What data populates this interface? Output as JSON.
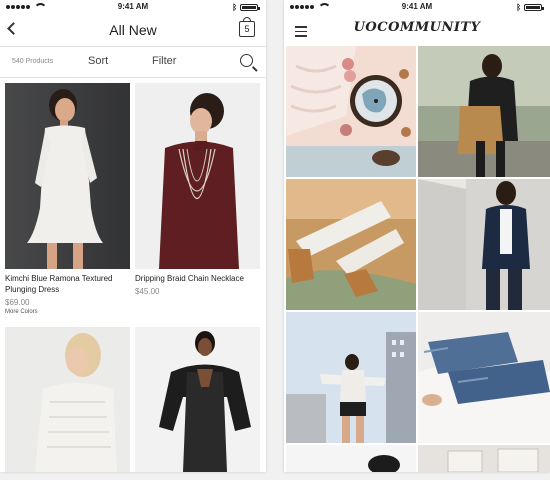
{
  "left": {
    "status": {
      "time": "9:41 AM"
    },
    "nav": {
      "title": "All New",
      "bag_count": "5"
    },
    "toolbar": {
      "count": "540 Products",
      "sort": "Sort",
      "filter": "Filter"
    },
    "products": [
      {
        "name": "Kimchi Blue Ramona Textured Plunging Dress",
        "price": "$69.00",
        "more": "More Colors"
      },
      {
        "name": "Dripping Braid Chain Necklace",
        "price": "$45.00",
        "more": ""
      },
      {
        "name": "",
        "price": "",
        "more": ""
      },
      {
        "name": "",
        "price": "",
        "more": ""
      }
    ]
  },
  "right": {
    "status": {
      "time": "9:41 AM"
    },
    "nav": {
      "brand": "UOCOMMUNITY"
    }
  },
  "colors": {
    "accent": "#222222",
    "muted": "#888888"
  }
}
